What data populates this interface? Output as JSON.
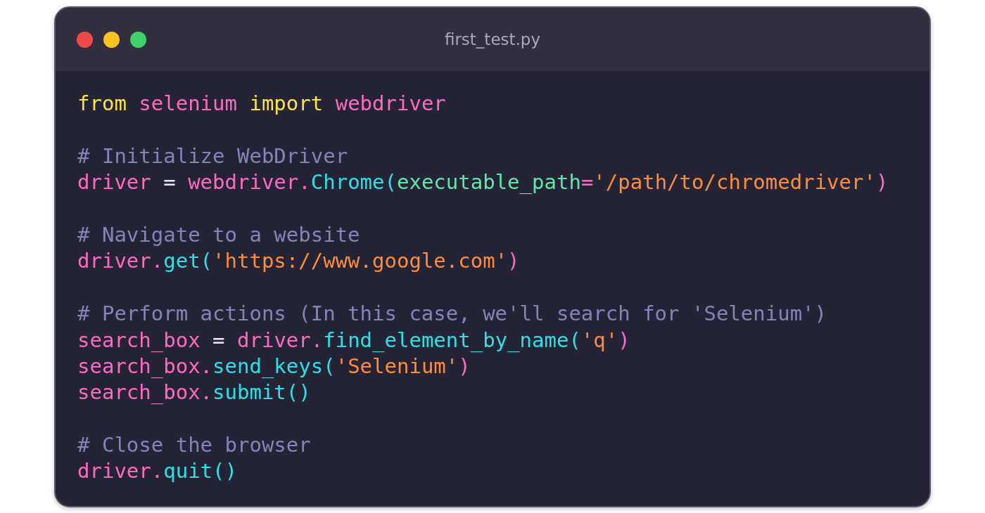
{
  "window": {
    "title": "first_test.py"
  },
  "code": [
    {
      "kind": "code",
      "tokens": [
        {
          "kind": "keyword",
          "text": "from "
        },
        {
          "kind": "name",
          "text": "selenium "
        },
        {
          "kind": "keyword",
          "text": "import "
        },
        {
          "kind": "name",
          "text": "webdriver"
        }
      ]
    },
    {
      "kind": "blank"
    },
    {
      "kind": "comment",
      "text": "# Initialize WebDriver"
    },
    {
      "kind": "code",
      "tokens": [
        {
          "kind": "name",
          "text": "driver"
        },
        {
          "kind": "plain",
          "text": " = "
        },
        {
          "kind": "name",
          "text": "webdriver."
        },
        {
          "kind": "func",
          "text": "Chrome("
        },
        {
          "kind": "param",
          "text": "executable_path"
        },
        {
          "kind": "name",
          "text": "="
        },
        {
          "kind": "string",
          "text": "'/path/to/chromedriver'"
        },
        {
          "kind": "name",
          "text": ")"
        }
      ]
    },
    {
      "kind": "blank"
    },
    {
      "kind": "comment",
      "text": "# Navigate to a website"
    },
    {
      "kind": "code",
      "tokens": [
        {
          "kind": "name",
          "text": "driver."
        },
        {
          "kind": "func",
          "text": "get("
        },
        {
          "kind": "string",
          "text": "'https://www.google.com'"
        },
        {
          "kind": "name",
          "text": ")"
        }
      ]
    },
    {
      "kind": "blank"
    },
    {
      "kind": "comment",
      "text": "# Perform actions (In this case, we'll search for 'Selenium')"
    },
    {
      "kind": "code",
      "tokens": [
        {
          "kind": "name",
          "text": "search_box"
        },
        {
          "kind": "plain",
          "text": " = "
        },
        {
          "kind": "name",
          "text": "driver."
        },
        {
          "kind": "func",
          "text": "find_element_by_name("
        },
        {
          "kind": "string",
          "text": "'q'"
        },
        {
          "kind": "name",
          "text": ")"
        }
      ]
    },
    {
      "kind": "code",
      "tokens": [
        {
          "kind": "name",
          "text": "search_box."
        },
        {
          "kind": "func",
          "text": "send_keys("
        },
        {
          "kind": "string",
          "text": "'Selenium'"
        },
        {
          "kind": "name",
          "text": ")"
        }
      ]
    },
    {
      "kind": "code",
      "tokens": [
        {
          "kind": "name",
          "text": "search_box."
        },
        {
          "kind": "func",
          "text": "submit()"
        }
      ]
    },
    {
      "kind": "blank"
    },
    {
      "kind": "comment",
      "text": "# Close the browser"
    },
    {
      "kind": "code",
      "tokens": [
        {
          "kind": "name",
          "text": "driver."
        },
        {
          "kind": "func",
          "text": "quit()"
        }
      ]
    }
  ]
}
